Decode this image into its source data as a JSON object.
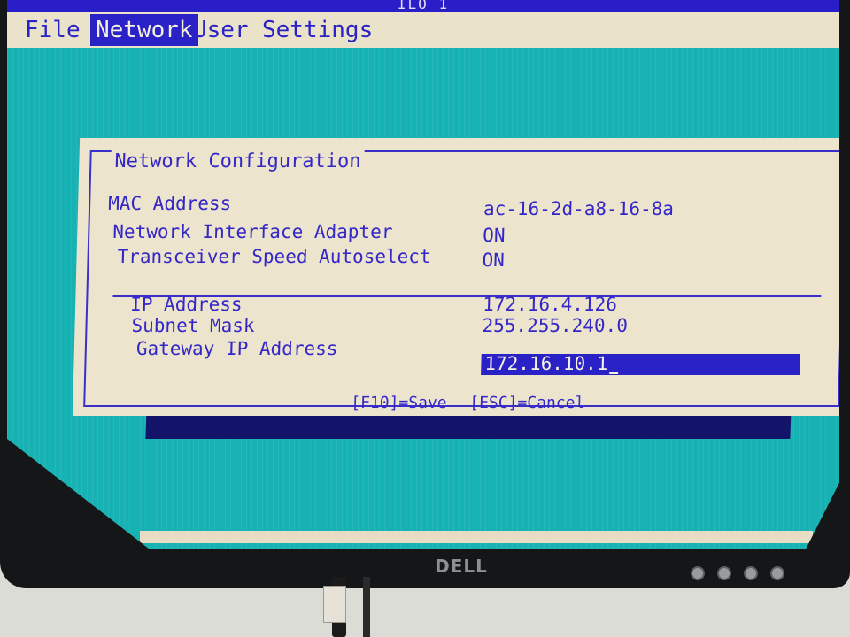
{
  "window": {
    "title": "ILO 1"
  },
  "menu": {
    "items": [
      {
        "label": "File",
        "active": false
      },
      {
        "label": "Network",
        "active": true
      },
      {
        "label": "User",
        "active": false
      },
      {
        "label": "Settings",
        "active": false
      }
    ]
  },
  "dialog": {
    "title": "Network Configuration",
    "rows": [
      {
        "label": "MAC Address",
        "value": "ac-16-2d-a8-16-8a"
      },
      {
        "label": "Network Interface Adapter",
        "value": "ON"
      },
      {
        "label": "Transceiver Speed Autoselect",
        "value": "ON"
      }
    ],
    "ip_rows": [
      {
        "label": "IP Address",
        "value": "172.16.4.126"
      },
      {
        "label": "Subnet Mask",
        "value": "255.255.240.0"
      },
      {
        "label": "Gateway IP Address",
        "value": "172.16.10.1"
      }
    ],
    "save_hint": "[F10]=Save",
    "cancel_hint": "[ESC]=Cancel"
  },
  "monitor": {
    "brand": "DELL"
  },
  "colors": {
    "screen_bg": "#17b2b3",
    "dialog_bg": "#ece4cc",
    "text": "#3427c8",
    "highlight": "#2a21c6"
  },
  "icons": {
    "monitor_buttons": [
      "button-icon",
      "button-icon",
      "button-icon",
      "power-icon"
    ]
  }
}
